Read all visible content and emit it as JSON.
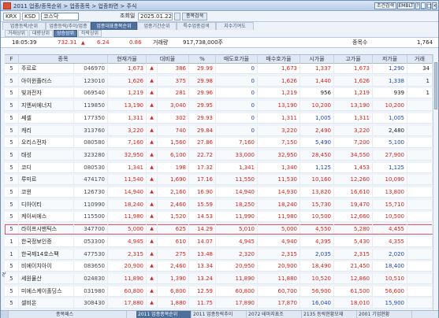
{
  "window": {
    "title": "2011 업종/종목순위 > 업종종목 > 업종화면 > 주식",
    "controls": [
      "조건검색",
      "EMBLT",
      "?",
      "_",
      "□",
      "×"
    ]
  },
  "toolbar": {
    "market": "KRX",
    "market_options": [
      "KRX",
      "KSD"
    ],
    "index_name": "코스닥",
    "date_label": "조회일",
    "date_value": "2025.01.22",
    "search_button": "종목검색"
  },
  "tabs": [
    "업종등락/순위",
    "업종등락/추이/업종",
    "업종대표종목순위",
    "업종기간순위",
    "특수업종검색",
    "지수기여도"
  ],
  "active_tab": 2,
  "subtabs": [
    "거래상위",
    "대량상위",
    "상승상위",
    "하락상위"
  ],
  "active_subtab": 2,
  "info": {
    "time": "18:05:39",
    "index_value": "732.31",
    "index_change": "6.24",
    "index_rate": "0.86",
    "volume_label": "거래량",
    "volume_value": "917,738,000주",
    "count_label": "종목수",
    "count_value": "1,764"
  },
  "columns": [
    "F",
    "종목",
    "현재가율",
    "대비율",
    "%",
    "매도호가율",
    "매수호가율",
    "시가율",
    "고가율",
    "저가율",
    "거래"
  ],
  "rows": [
    {
      "f": "5",
      "name": "주르로",
      "code": "046970",
      "price": "1,673",
      "arrow": "▲",
      "diff": "386",
      "pct": "29.99",
      "ask": "0",
      "bid": "1,673",
      "open": "1,337",
      "high": "1,673",
      "low": "1,290",
      "vol": "34",
      "colors": [
        "red",
        "red",
        "red",
        "blue",
        "red",
        "red",
        "red",
        "blue"
      ]
    },
    {
      "f": "5",
      "name": "아이윈플러스",
      "code": "123010",
      "price": "1,626",
      "arrow": "▲",
      "diff": "375",
      "pct": "29.98",
      "ask": "0",
      "bid": "1,626",
      "open": "1,440",
      "high": "1,626",
      "low": "1,338",
      "vol": "1",
      "colors": [
        "red",
        "red",
        "red",
        "blue",
        "red",
        "red",
        "red",
        "blue"
      ]
    },
    {
      "f": "5",
      "name": "빛과전자",
      "code": "069540",
      "price": "1,219",
      "arrow": "▲",
      "diff": "281",
      "pct": "29.96",
      "ask": "0",
      "bid": "1,219",
      "open": "956",
      "high": "1,219",
      "low": "939",
      "vol": "1",
      "colors": [
        "red",
        "red",
        "red",
        "blue",
        "red",
        "black",
        "red",
        "black"
      ]
    },
    {
      "f": "5",
      "name": "지엔씨에너지",
      "code": "119850",
      "price": "13,190",
      "arrow": "▲",
      "diff": "3,040",
      "pct": "29.95",
      "ask": "0",
      "bid": "13,190",
      "open": "10,200",
      "high": "13,190",
      "low": "10,200",
      "vol": "",
      "colors": [
        "red",
        "red",
        "red",
        "blue",
        "red",
        "red",
        "red",
        "red"
      ]
    },
    {
      "f": "5",
      "name": "쎄셀",
      "code": "177350",
      "price": "1,311",
      "arrow": "▲",
      "diff": "302",
      "pct": "29.93",
      "ask": "0",
      "bid": "1,311",
      "open": "1,005",
      "high": "1,311",
      "low": "1,005",
      "vol": "",
      "colors": [
        "red",
        "red",
        "red",
        "blue",
        "red",
        "blue",
        "red",
        "blue"
      ]
    },
    {
      "f": "5",
      "name": "캐리",
      "code": "313760",
      "price": "3,220",
      "arrow": "▲",
      "diff": "740",
      "pct": "29.84",
      "ask": "0",
      "bid": "3,220",
      "open": "2,490",
      "high": "3,220",
      "low": "2,480",
      "vol": "",
      "colors": [
        "red",
        "red",
        "red",
        "blue",
        "red",
        "red",
        "red",
        "black"
      ]
    },
    {
      "f": "5",
      "name": "오리스전자",
      "code": "080580",
      "price": "7,160",
      "arrow": "▲",
      "diff": "1,560",
      "pct": "27.86",
      "ask": "7,160",
      "bid": "7,150",
      "open": "5,490",
      "high": "7,200",
      "low": "5,100",
      "vol": "",
      "colors": [
        "red",
        "red",
        "red",
        "red",
        "red",
        "blue",
        "red",
        "blue"
      ]
    },
    {
      "f": "5",
      "name": "태성",
      "code": "323280",
      "price": "32,950",
      "arrow": "▲",
      "diff": "6,100",
      "pct": "22.72",
      "ask": "33,000",
      "bid": "32,950",
      "open": "28,450",
      "high": "34,550",
      "low": "27,900",
      "vol": "",
      "colors": [
        "red",
        "red",
        "red",
        "red",
        "red",
        "red",
        "red",
        "red"
      ]
    },
    {
      "f": "5",
      "name": "코디",
      "code": "080530",
      "price": "1,341",
      "arrow": "▲",
      "diff": "198",
      "pct": "17.32",
      "ask": "1,341",
      "bid": "1,340",
      "open": "1,125",
      "high": "1,453",
      "low": "1,125",
      "vol": "",
      "colors": [
        "red",
        "red",
        "red",
        "red",
        "red",
        "blue",
        "red",
        "blue"
      ]
    },
    {
      "f": "5",
      "name": "루미르",
      "code": "474170",
      "price": "11,540",
      "arrow": "▲",
      "diff": "1,690",
      "pct": "17.16",
      "ask": "11,550",
      "bid": "11,530",
      "open": "10,160",
      "high": "12,260",
      "low": "10,090",
      "vol": "",
      "colors": [
        "red",
        "red",
        "red",
        "red",
        "red",
        "red",
        "red",
        "red"
      ]
    },
    {
      "f": "5",
      "name": "코윈",
      "code": "126730",
      "price": "14,940",
      "arrow": "▲",
      "diff": "2,160",
      "pct": "16.90",
      "ask": "14,940",
      "bid": "14,930",
      "open": "13,820",
      "high": "16,610",
      "low": "13,800",
      "vol": "",
      "colors": [
        "red",
        "red",
        "red",
        "red",
        "red",
        "red",
        "red",
        "red"
      ]
    },
    {
      "f": "5",
      "name": "디아이티",
      "code": "110990",
      "price": "18,240",
      "arrow": "▲",
      "diff": "2,460",
      "pct": "15.59",
      "ask": "18,250",
      "bid": "18,240",
      "open": "15,730",
      "high": "19,470",
      "low": "15,710",
      "vol": "",
      "colors": [
        "red",
        "red",
        "red",
        "red",
        "red",
        "red",
        "red",
        "red"
      ]
    },
    {
      "f": "5",
      "name": "케이씨에스",
      "code": "115500",
      "price": "11,980",
      "arrow": "▲",
      "diff": "1,520",
      "pct": "14.53",
      "ask": "11,990",
      "bid": "11,980",
      "open": "10,500",
      "high": "12,660",
      "low": "10,500",
      "vol": "",
      "colors": [
        "red",
        "red",
        "red",
        "red",
        "red",
        "red",
        "red",
        "red"
      ]
    },
    {
      "f": "5",
      "name": "라이프시맨틱스",
      "code": "347700",
      "price": "5,000",
      "arrow": "▲",
      "diff": "625",
      "pct": "14.29",
      "ask": "5,010",
      "bid": "5,000",
      "open": "4,550",
      "high": "5,280",
      "low": "4,455",
      "vol": "",
      "colors": [
        "red",
        "red",
        "red",
        "red",
        "red",
        "red",
        "red",
        "red"
      ]
    },
    {
      "f": "1",
      "name": "한국정보인증",
      "code": "053300",
      "price": "4,945",
      "arrow": "▲",
      "diff": "610",
      "pct": "14.07",
      "ask": "4,945",
      "bid": "4,940",
      "open": "4,395",
      "high": "5,430",
      "low": "4,355",
      "vol": "",
      "colors": [
        "red",
        "red",
        "red",
        "red",
        "red",
        "red",
        "red",
        "red"
      ]
    },
    {
      "f": "1",
      "name": "한국제14호스팩",
      "code": "477530",
      "price": "2,315",
      "arrow": "▲",
      "diff": "275",
      "pct": "13.48",
      "ask": "2,320",
      "bid": "2,315",
      "open": "2,035",
      "high": "2,315",
      "low": "2,020",
      "vol": "",
      "colors": [
        "red",
        "red",
        "red",
        "red",
        "red",
        "blue",
        "red",
        "blue"
      ]
    },
    {
      "f": "5",
      "name": "비에이치아이",
      "code": "083650",
      "price": "20,900",
      "arrow": "▲",
      "diff": "2,460",
      "pct": "13.34",
      "ask": "20,950",
      "bid": "20,900",
      "open": "18,490",
      "high": "21,450",
      "low": "18,400",
      "vol": "",
      "colors": [
        "red",
        "red",
        "red",
        "red",
        "red",
        "red",
        "red",
        "blue"
      ]
    },
    {
      "f": "5",
      "name": "세원물산",
      "code": "024830",
      "price": "11,890",
      "arrow": "▲",
      "diff": "1,390",
      "pct": "13.24",
      "ask": "11,890",
      "bid": "11,880",
      "open": "10,520",
      "high": "12,860",
      "low": "10,510",
      "vol": "",
      "colors": [
        "red",
        "red",
        "red",
        "red",
        "red",
        "red",
        "red",
        "red"
      ]
    },
    {
      "f": "5",
      "name": "미에스케이홀딩스",
      "code": "031980",
      "price": "60,800",
      "arrow": "▲",
      "diff": "6,800",
      "pct": "12.59",
      "ask": "60,800",
      "bid": "60,700",
      "open": "56,900",
      "high": "61,500",
      "low": "56,600",
      "vol": "",
      "colors": [
        "red",
        "red",
        "red",
        "red",
        "red",
        "red",
        "red",
        "red"
      ]
    },
    {
      "f": "5",
      "name": "셀비온",
      "code": "308430",
      "price": "17,880",
      "arrow": "▲",
      "diff": "1,880",
      "pct": "11.75",
      "ask": "17,890",
      "bid": "17,870",
      "open": "16,040",
      "high": "18,010",
      "low": "15,900",
      "vol": "",
      "colors": [
        "red",
        "red",
        "red",
        "red",
        "red",
        "blue",
        "red",
        "blue"
      ]
    }
  ],
  "selected_row": 13,
  "side_label": "경",
  "bottom_tabs": [
    "종목패스",
    "2011 업종종목순위",
    "2011 업종등락추이",
    "2072 테마지표조",
    "2135 등락현황모재",
    "2001 기업현황"
  ],
  "active_bottom_tab": 1
}
